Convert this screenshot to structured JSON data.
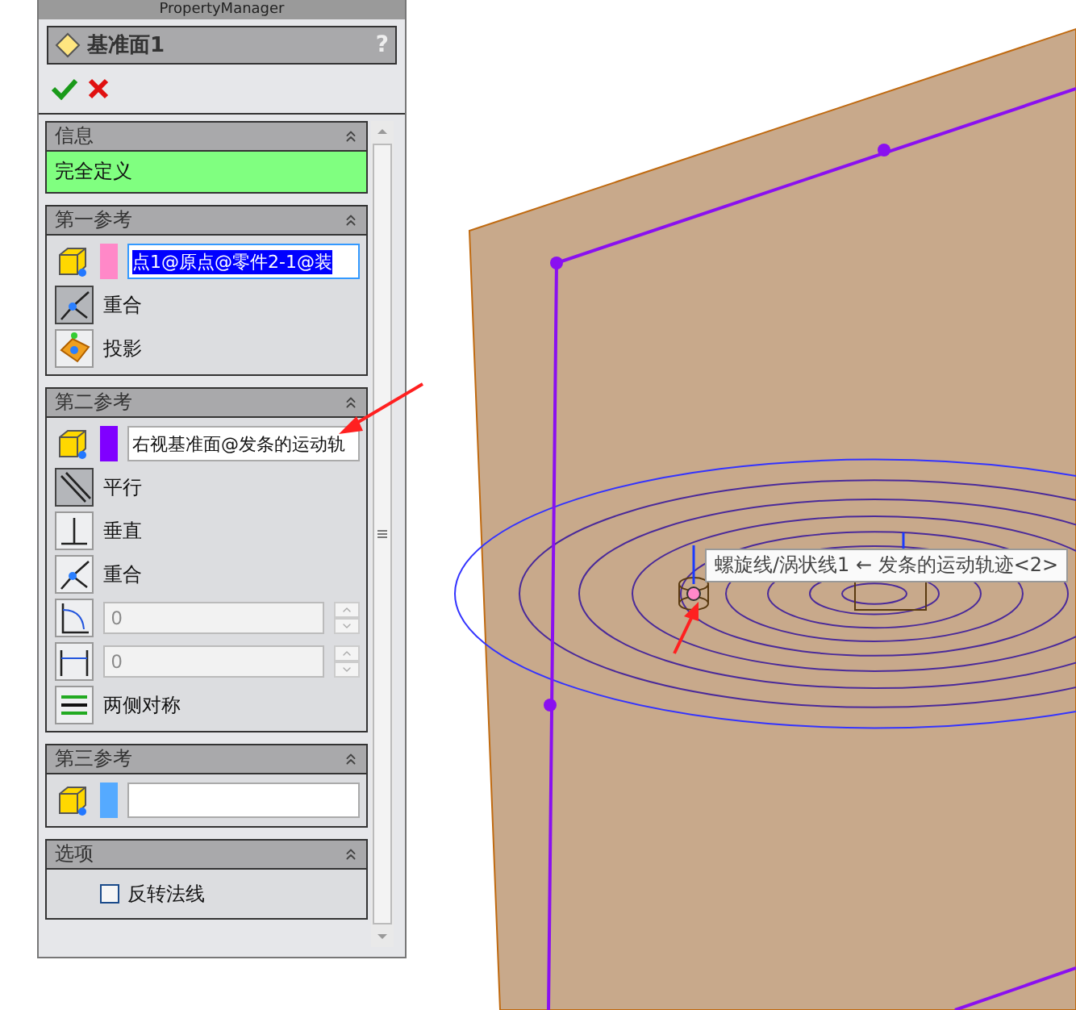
{
  "panel": {
    "title": "PropertyManager",
    "feature_title": "基准面1",
    "help": "?",
    "groups": [
      {
        "title": "信息",
        "expanded": true,
        "items": [
          {
            "kind": "status",
            "text": "完全定义"
          }
        ]
      },
      {
        "title": "第一参考",
        "expanded": true,
        "items": [
          {
            "kind": "selection",
            "text": "点1@原点@零件2-1@装",
            "color": "#ff88c8",
            "focused": true
          },
          {
            "kind": "coincident",
            "label": "重合",
            "selected": true
          },
          {
            "kind": "projection",
            "label": "投影",
            "selected": false
          }
        ]
      },
      {
        "title": "第二参考",
        "expanded": true,
        "items": [
          {
            "kind": "selection",
            "text": "右视基准面@发条的运动轨",
            "color": "#8000ff",
            "focused": false
          },
          {
            "kind": "parallel",
            "label": "平行",
            "selected": true
          },
          {
            "kind": "perpendicular",
            "label": "垂直",
            "selected": false
          },
          {
            "kind": "coincident",
            "label": "重合",
            "selected": false
          },
          {
            "kind": "angle",
            "value": "0",
            "disabled": true
          },
          {
            "kind": "distance",
            "value": "0",
            "disabled": true
          },
          {
            "kind": "symmetric",
            "label": "两侧对称",
            "selected": false
          }
        ]
      },
      {
        "title": "第三参考",
        "expanded": true,
        "items": [
          {
            "kind": "selection",
            "color": "#55aaff",
            "focused": false
          }
        ]
      },
      {
        "title": "选项",
        "expanded": true,
        "items": [
          {
            "kind": "checkbox",
            "label": "反转法线",
            "checked": false
          }
        ]
      }
    ]
  },
  "viewport": {
    "tooltip": "螺旋线/涡状线1 ← 发条的运动轨迹<2>"
  }
}
